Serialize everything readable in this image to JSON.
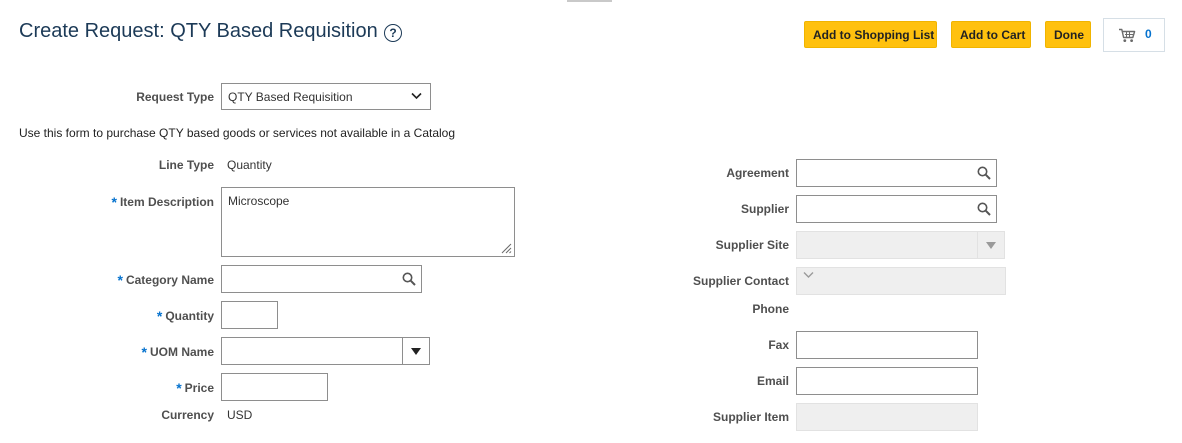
{
  "header": {
    "title": "Create Request: QTY Based Requisition",
    "help_glyph": "?",
    "buttons": {
      "add_to_shopping_list": "Add to Shopping List",
      "add_to_cart": "Add to Cart",
      "done": "Done"
    },
    "cart_count": "0"
  },
  "form": {
    "request_type": {
      "label": "Request Type",
      "value": "QTY Based Requisition"
    },
    "info_text": "Use this form to purchase QTY based goods or services not available in a Catalog",
    "line_type": {
      "label": "Line Type",
      "value": "Quantity"
    },
    "item_description": {
      "label": "Item Description",
      "value": "Microscope"
    },
    "category_name": {
      "label": "Category Name",
      "value": ""
    },
    "quantity": {
      "label": "Quantity",
      "value": ""
    },
    "uom_name": {
      "label": "UOM Name",
      "value": ""
    },
    "price": {
      "label": "Price",
      "value": ""
    },
    "currency": {
      "label": "Currency",
      "value": "USD"
    },
    "agreement": {
      "label": "Agreement",
      "value": ""
    },
    "supplier": {
      "label": "Supplier",
      "value": ""
    },
    "supplier_site": {
      "label": "Supplier Site",
      "value": ""
    },
    "supplier_contact": {
      "label": "Supplier Contact",
      "value": ""
    },
    "phone": {
      "label": "Phone",
      "value": ""
    },
    "fax": {
      "label": "Fax",
      "value": ""
    },
    "email": {
      "label": "Email",
      "value": ""
    },
    "supplier_item": {
      "label": "Supplier Item",
      "value": ""
    }
  },
  "colors": {
    "button_yellow": "#ffc10e",
    "title_navy": "#1c3a57",
    "required_blue": "#0572ce",
    "cart_count_blue": "#0572ce"
  },
  "icons": [
    "help-icon",
    "cart-icon",
    "search-icon",
    "chevron-down-icon",
    "dropdown-triangle-icon"
  ]
}
